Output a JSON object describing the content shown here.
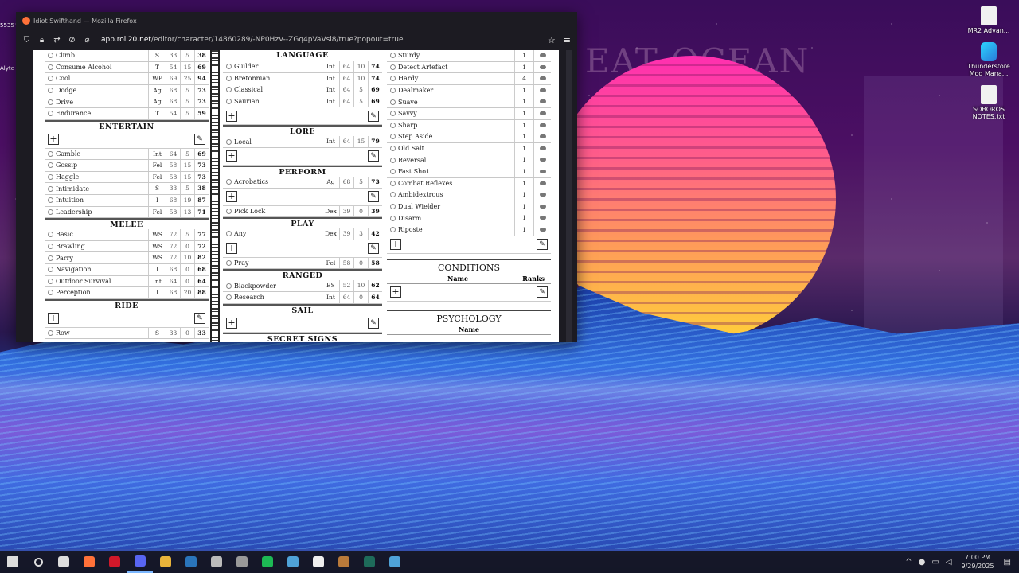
{
  "window": {
    "title": "Idiot Swifthand — Mozilla Firefox",
    "url_domain": "app.roll20.net",
    "url_path": "/editor/character/14860289/-NP0HzV--ZGq4pVaVsl8/true?popout=true"
  },
  "desktop": {
    "faint_title": "EAT OCEAN",
    "left_labels": [
      "5535",
      "Alyte"
    ],
    "icons": [
      {
        "label": "MR2 Advan...",
        "icon": "file-icon"
      },
      {
        "label": "Thunderstore Mod Mana...",
        "icon": "thunderstore-icon"
      },
      {
        "label": "SOBOROS NOTES.txt",
        "icon": "text-file-icon"
      }
    ]
  },
  "col1": {
    "top_rows": [
      {
        "name": "Climb",
        "ch": "S",
        "a": "33",
        "b": "5",
        "t": "38"
      },
      {
        "name": "Consume Alcohol",
        "ch": "T",
        "a": "54",
        "b": "15",
        "t": "69"
      },
      {
        "name": "Cool",
        "ch": "WP",
        "a": "69",
        "b": "25",
        "t": "94"
      },
      {
        "name": "Dodge",
        "ch": "Ag",
        "a": "68",
        "b": "5",
        "t": "73"
      },
      {
        "name": "Drive",
        "ch": "Ag",
        "a": "68",
        "b": "5",
        "t": "73"
      },
      {
        "name": "Endurance",
        "ch": "T",
        "a": "54",
        "b": "5",
        "t": "59"
      }
    ],
    "entertain_title": "ENTERTAIN",
    "mid_rows": [
      {
        "name": "Gamble",
        "ch": "Int",
        "a": "64",
        "b": "5",
        "t": "69"
      },
      {
        "name": "Gossip",
        "ch": "Fel",
        "a": "58",
        "b": "15",
        "t": "73"
      },
      {
        "name": "Haggle",
        "ch": "Fel",
        "a": "58",
        "b": "15",
        "t": "73"
      },
      {
        "name": "Intimidate",
        "ch": "S",
        "a": "33",
        "b": "5",
        "t": "38"
      },
      {
        "name": "Intuition",
        "ch": "I",
        "a": "68",
        "b": "19",
        "t": "87"
      },
      {
        "name": "Leadership",
        "ch": "Fel",
        "a": "58",
        "b": "13",
        "t": "71"
      }
    ],
    "melee_title": "MELEE",
    "low_rows": [
      {
        "name": "Basic",
        "ch": "WS",
        "a": "72",
        "b": "5",
        "t": "77"
      },
      {
        "name": "Brawling",
        "ch": "WS",
        "a": "72",
        "b": "0",
        "t": "72"
      },
      {
        "name": "Parry",
        "ch": "WS",
        "a": "72",
        "b": "10",
        "t": "82"
      },
      {
        "name": "Navigation",
        "ch": "I",
        "a": "68",
        "b": "0",
        "t": "68"
      },
      {
        "name": "Outdoor Survival",
        "ch": "Int",
        "a": "64",
        "b": "0",
        "t": "64"
      },
      {
        "name": "Perception",
        "ch": "I",
        "a": "68",
        "b": "20",
        "t": "88"
      }
    ],
    "ride_title": "RIDE",
    "bottom_rows": [
      {
        "name": "Row",
        "ch": "S",
        "a": "33",
        "b": "0",
        "t": "33"
      }
    ]
  },
  "col2": {
    "language_title": "LANGUAGE",
    "language_rows": [
      {
        "name": "Guilder",
        "ch": "Int",
        "a": "64",
        "b": "10",
        "t": "74"
      },
      {
        "name": "Bretonnian",
        "ch": "Int",
        "a": "64",
        "b": "10",
        "t": "74"
      },
      {
        "name": "Classical",
        "ch": "Int",
        "a": "64",
        "b": "5",
        "t": "69"
      },
      {
        "name": "Saurian",
        "ch": "Int",
        "a": "64",
        "b": "5",
        "t": "69"
      }
    ],
    "lore_title": "LORE",
    "lore_rows": [
      {
        "name": "Local",
        "ch": "Int",
        "a": "64",
        "b": "15",
        "t": "79"
      }
    ],
    "perform_title": "PERFORM",
    "perform_rows": [
      {
        "name": "Acrobatics",
        "ch": "Ag",
        "a": "68",
        "b": "5",
        "t": "73"
      }
    ],
    "picklock_rows": [
      {
        "name": "Pick Lock",
        "ch": "Dex",
        "a": "39",
        "b": "0",
        "t": "39"
      }
    ],
    "play_title": "PLAY",
    "play_rows": [
      {
        "name": "Any",
        "ch": "Dex",
        "a": "39",
        "b": "3",
        "t": "42"
      }
    ],
    "pray_rows": [
      {
        "name": "Pray",
        "ch": "Fel",
        "a": "58",
        "b": "0",
        "t": "58"
      }
    ],
    "ranged_title": "RANGED",
    "ranged_rows": [
      {
        "name": "Blackpowder",
        "ch": "BS",
        "a": "52",
        "b": "10",
        "t": "62"
      },
      {
        "name": "Research",
        "ch": "Int",
        "a": "64",
        "b": "0",
        "t": "64"
      }
    ],
    "sail_title": "SAIL",
    "secret_title": "SECRET SIGNS"
  },
  "col3": {
    "talents": [
      {
        "name": "Sturdy",
        "rank": "1"
      },
      {
        "name": "Detect Artefact",
        "rank": "1"
      },
      {
        "name": "Hardy",
        "rank": "4"
      },
      {
        "name": "Dealmaker",
        "rank": "1"
      },
      {
        "name": "Suave",
        "rank": "1"
      },
      {
        "name": "Savvy",
        "rank": "1"
      },
      {
        "name": "Sharp",
        "rank": "1"
      },
      {
        "name": "Step Aside",
        "rank": "1"
      },
      {
        "name": "Old Salt",
        "rank": "1"
      },
      {
        "name": "Reversal",
        "rank": "1"
      },
      {
        "name": "Fast Shot",
        "rank": "1"
      },
      {
        "name": "Combat Reflexes",
        "rank": "1"
      },
      {
        "name": "Ambidextrous",
        "rank": "1"
      },
      {
        "name": "Dual Wielder",
        "rank": "1"
      },
      {
        "name": "Disarm",
        "rank": "1"
      },
      {
        "name": "Riposte",
        "rank": "1"
      }
    ],
    "conditions_title": "CONDITIONS",
    "conditions_name": "Name",
    "conditions_ranks": "Ranks",
    "psychology_title": "PSYCHOLOGY",
    "psychology_name": "Name"
  },
  "taskbar": {
    "time": "7:00 PM",
    "date": "9/29/2025",
    "apps": [
      "start-icon",
      "search-icon",
      "explorer-icon",
      "firefox-icon",
      "opera-icon",
      "discord-icon",
      "files-icon",
      "steam-icon",
      "github-icon",
      "unity-icon",
      "spotify-icon",
      "app-c-icon",
      "app-dc-icon",
      "blender-icon",
      "app-x-icon",
      "app-c2-icon"
    ]
  }
}
